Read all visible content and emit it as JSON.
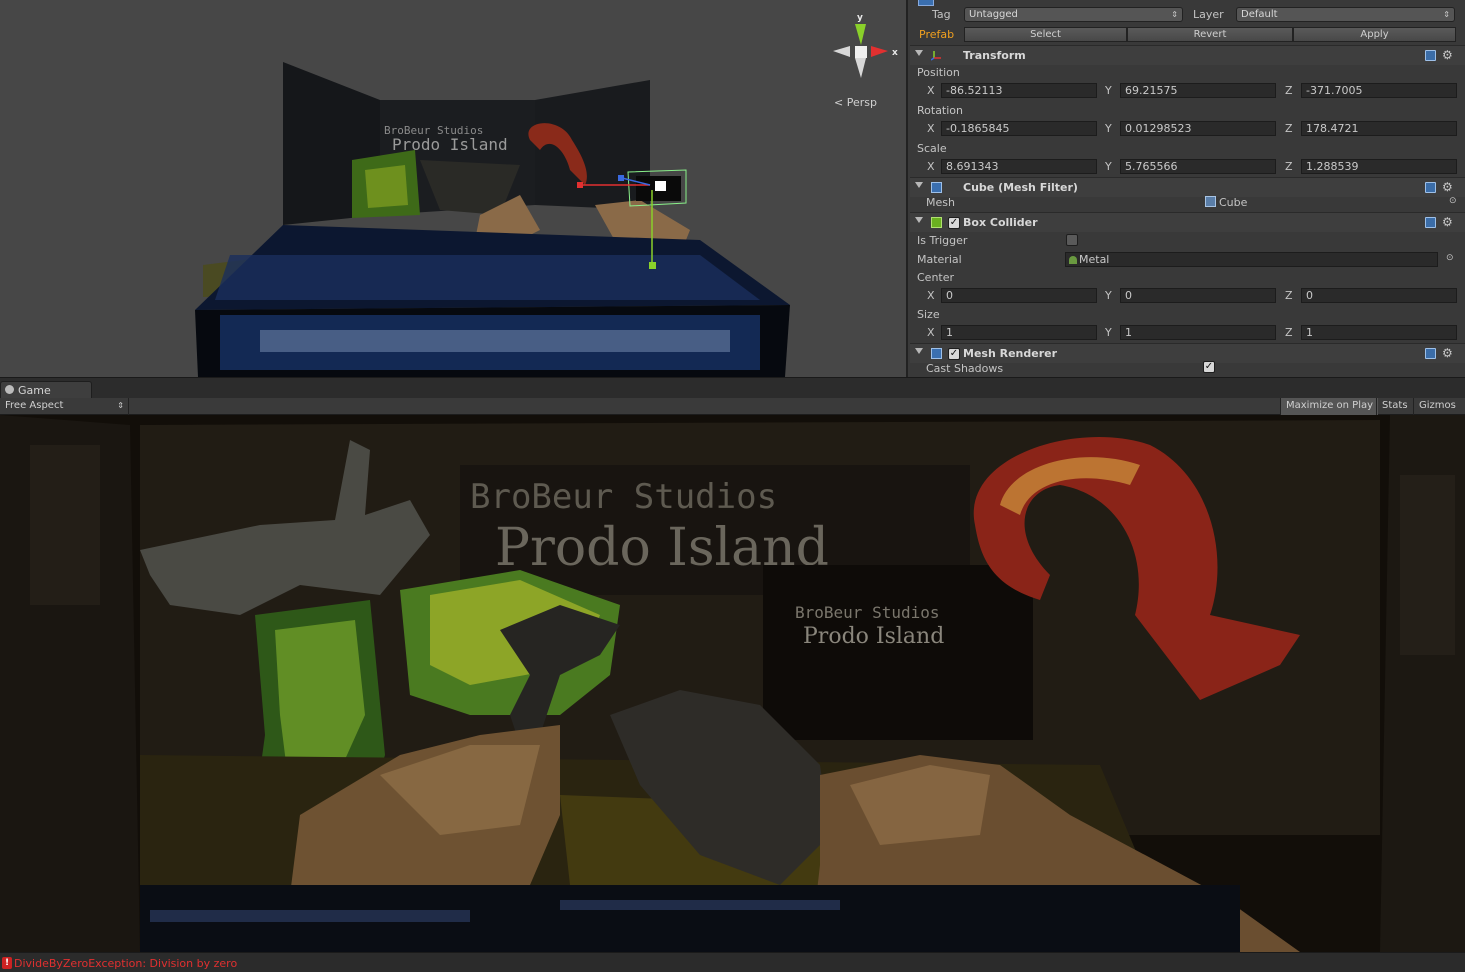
{
  "scene": {
    "projection_label": "Persp",
    "gizmo_axis_y": "y",
    "gizmo_axis_x": "x",
    "sign_line1": "BroBeur Studios",
    "sign_line2": "Prodo Island"
  },
  "inspector": {
    "tag_label": "Tag",
    "tag_value": "Untagged",
    "layer_label": "Layer",
    "layer_value": "Default",
    "prefab_label": "Prefab",
    "prefab_buttons": [
      "Select",
      "Revert",
      "Apply"
    ],
    "transform": {
      "title": "Transform",
      "position_label": "Position",
      "position": {
        "x": "-86.52113",
        "y": "69.21575",
        "z": "-371.7005"
      },
      "rotation_label": "Rotation",
      "rotation": {
        "x": "-0.1865845",
        "y": "0.01298523",
        "z": "178.4721"
      },
      "scale_label": "Scale",
      "scale": {
        "x": "8.691343",
        "y": "5.765566",
        "z": "1.288539"
      }
    },
    "mesh_filter": {
      "title": "Cube (Mesh Filter)",
      "mesh_label": "Mesh",
      "mesh_value": "Cube"
    },
    "box_collider": {
      "title": "Box Collider",
      "enabled": true,
      "is_trigger_label": "Is Trigger",
      "is_trigger": false,
      "material_label": "Material",
      "material_value": "Metal",
      "center_label": "Center",
      "center": {
        "x": "0",
        "y": "0",
        "z": "0"
      },
      "size_label": "Size",
      "size": {
        "x": "1",
        "y": "1",
        "z": "1"
      }
    },
    "mesh_renderer": {
      "title": "Mesh Renderer",
      "enabled": true,
      "cast_shadows_label": "Cast Shadows",
      "cast_shadows": true
    },
    "axis_labels": {
      "x": "X",
      "y": "Y",
      "z": "Z"
    }
  },
  "game": {
    "tab_label": "Game",
    "aspect_value": "Free Aspect",
    "toolbar_buttons": {
      "maximize": "Maximize on Play",
      "stats": "Stats",
      "gizmos": "Gizmos"
    },
    "sign_line1": "BroBeur Studios",
    "sign_line2": "Prodo Island",
    "small_sign_line1": "BroBeur Studios",
    "small_sign_line2": "Prodo Island"
  },
  "status": {
    "message": "DivideByZeroException: Division by zero"
  },
  "colors": {
    "prefab_orange": "#f0a020",
    "error_red": "#e03030",
    "axis_red": "#e23030",
    "axis_green": "#8ad02a",
    "axis_blue": "#3a6ae0"
  }
}
